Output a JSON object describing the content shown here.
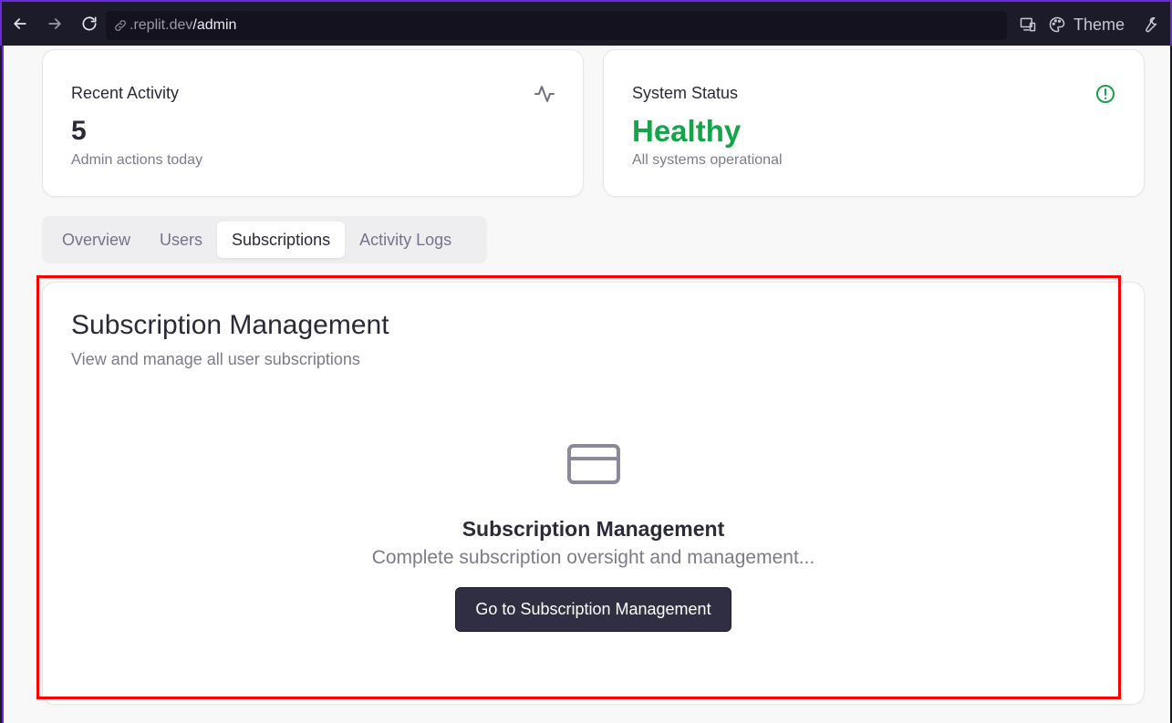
{
  "browser": {
    "url_host": ".replit.dev",
    "url_path": "/admin",
    "theme_label": "Theme"
  },
  "stats": {
    "recent_activity": {
      "title": "Recent Activity",
      "value": "5",
      "subtitle": "Admin actions today",
      "icon": "activity-icon"
    },
    "system_status": {
      "title": "System Status",
      "value": "Healthy",
      "subtitle": "All systems operational",
      "icon": "alert-circle-icon",
      "color": "#16a34a"
    }
  },
  "tabs": [
    {
      "label": "Overview",
      "active": false
    },
    {
      "label": "Users",
      "active": false
    },
    {
      "label": "Subscriptions",
      "active": true
    },
    {
      "label": "Activity Logs",
      "active": false
    }
  ],
  "main": {
    "title": "Subscription Management",
    "subtitle": "View and manage all user subscriptions",
    "icon": "credit-card-icon",
    "center_title": "Subscription Management",
    "center_subtitle": "Complete subscription oversight and management...",
    "button_label": "Go to Subscription Management"
  },
  "colors": {
    "highlight": "#ff0000",
    "primary_button": "#2f2e42",
    "healthy": "#16a34a"
  }
}
